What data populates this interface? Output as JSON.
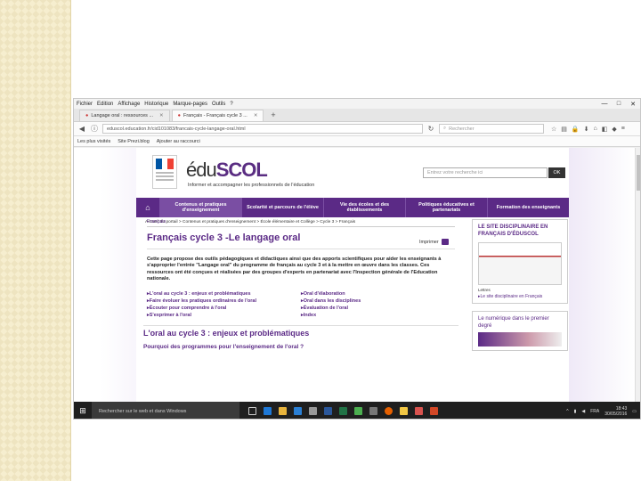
{
  "browser": {
    "menu": [
      "Fichier",
      "Edition",
      "Affichage",
      "Historique",
      "Marque-pages",
      "Outils",
      "?"
    ],
    "window_buttons": [
      "—",
      "□",
      "✕"
    ],
    "tabs": [
      {
        "label": "Langage oral : ressources ..."
      },
      {
        "label": "Français - Français cycle 3 ..."
      }
    ],
    "new_tab": "+",
    "url": "eduscol.education.fr/cid101083/francais-cycle-langage-oral.html",
    "search_placeholder": "Rechercher",
    "bookmarks": [
      "Les plus visités",
      "Site Prezi.blog",
      "Ajouter au raccourci"
    ]
  },
  "site": {
    "logo_plain": "édu",
    "logo_bold": "SCOL",
    "tagline": "Informer et accompagner les professionnels de l'éducation",
    "search_placeholder": "Entrez votre recherche ici",
    "search_button": "OK",
    "nav": [
      "Contenus et pratiques d'enseignement",
      "Scolarité et parcours de l'élève",
      "Vie des écoles et des établissements",
      "Politiques éducatives et partenariats",
      "Formation des enseignants"
    ],
    "breadcrumb": "Accueil du portail > Contenus et pratiques d'enseignement > École élémentaire et Collège > Cycle 3 > Français",
    "subject": "Français",
    "title": "Français cycle 3 -Le langage oral",
    "print_label": "Imprimer",
    "intro": "Cette page propose des outils pédagogiques et didactiques ainsi que des apports scientifiques pour aider les enseignants à s'approprier l'entrée \"Langage oral\" du programme de français au cycle 3 et à la mettre en œuvre dans les classes. Ces ressources ont été conçues et réalisées par des groupes d'experts en partenariat avec l'Inspection générale de l'Education nationale.",
    "links": [
      "L'oral au cycle 3 : enjeux et problématiques",
      "Oral d'élaboration",
      "Faire évoluer les pratiques ordinaires de l'oral",
      "Oral dans les disciplines",
      "Écouter pour comprendre à l'oral",
      "Évaluation de l'oral",
      "S'exprimer à l'oral",
      "Index"
    ],
    "section_title": "L'oral au cycle 3 : enjeux et problématiques",
    "section_question": "Pourquoi des programmes pour l'enseignement de l'oral ?",
    "sidebar": {
      "box1_title": "LE SITE DISCIPLINAIRE EN FRANÇAIS D'ÉDUSCOL",
      "box1_caption": "Lettres",
      "box1_link": "Le site disciplinaire en Français",
      "box2_title": "Le numérique dans le premier degré"
    }
  },
  "taskbar": {
    "search": "Rechercher sur le web et dans Windows",
    "lang": "FRA",
    "time": "18:43",
    "date": "30/05/2016"
  }
}
